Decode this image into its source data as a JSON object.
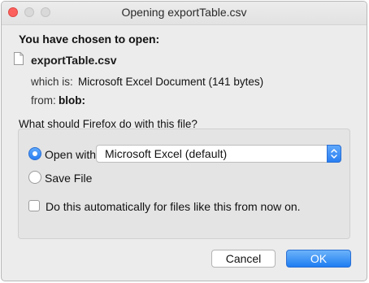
{
  "window": {
    "title": "Opening exportTable.csv"
  },
  "dialog": {
    "heading": "You have chosen to open:",
    "file_name": "exportTable.csv",
    "which_is_label": "which is:",
    "which_is_value": "Microsoft Excel Document (141 bytes)",
    "from_label": "from:",
    "from_value": "blob:",
    "question": "What should Firefox do with this file?",
    "options": {
      "open_with_label": "Open with",
      "open_with_selected": true,
      "application_value": "Microsoft Excel (default)",
      "save_file_label": "Save File",
      "save_file_selected": false,
      "auto_label": "Do this automatically for files like this from now on.",
      "auto_checked": false
    },
    "buttons": {
      "cancel": "Cancel",
      "ok": "OK"
    }
  },
  "colors": {
    "accent": "#2a7ef2",
    "close": "#fc605c",
    "window_bg": "#ececec"
  },
  "icons": {
    "file": "document-icon",
    "stepper": "up-down-chevron-icon"
  }
}
